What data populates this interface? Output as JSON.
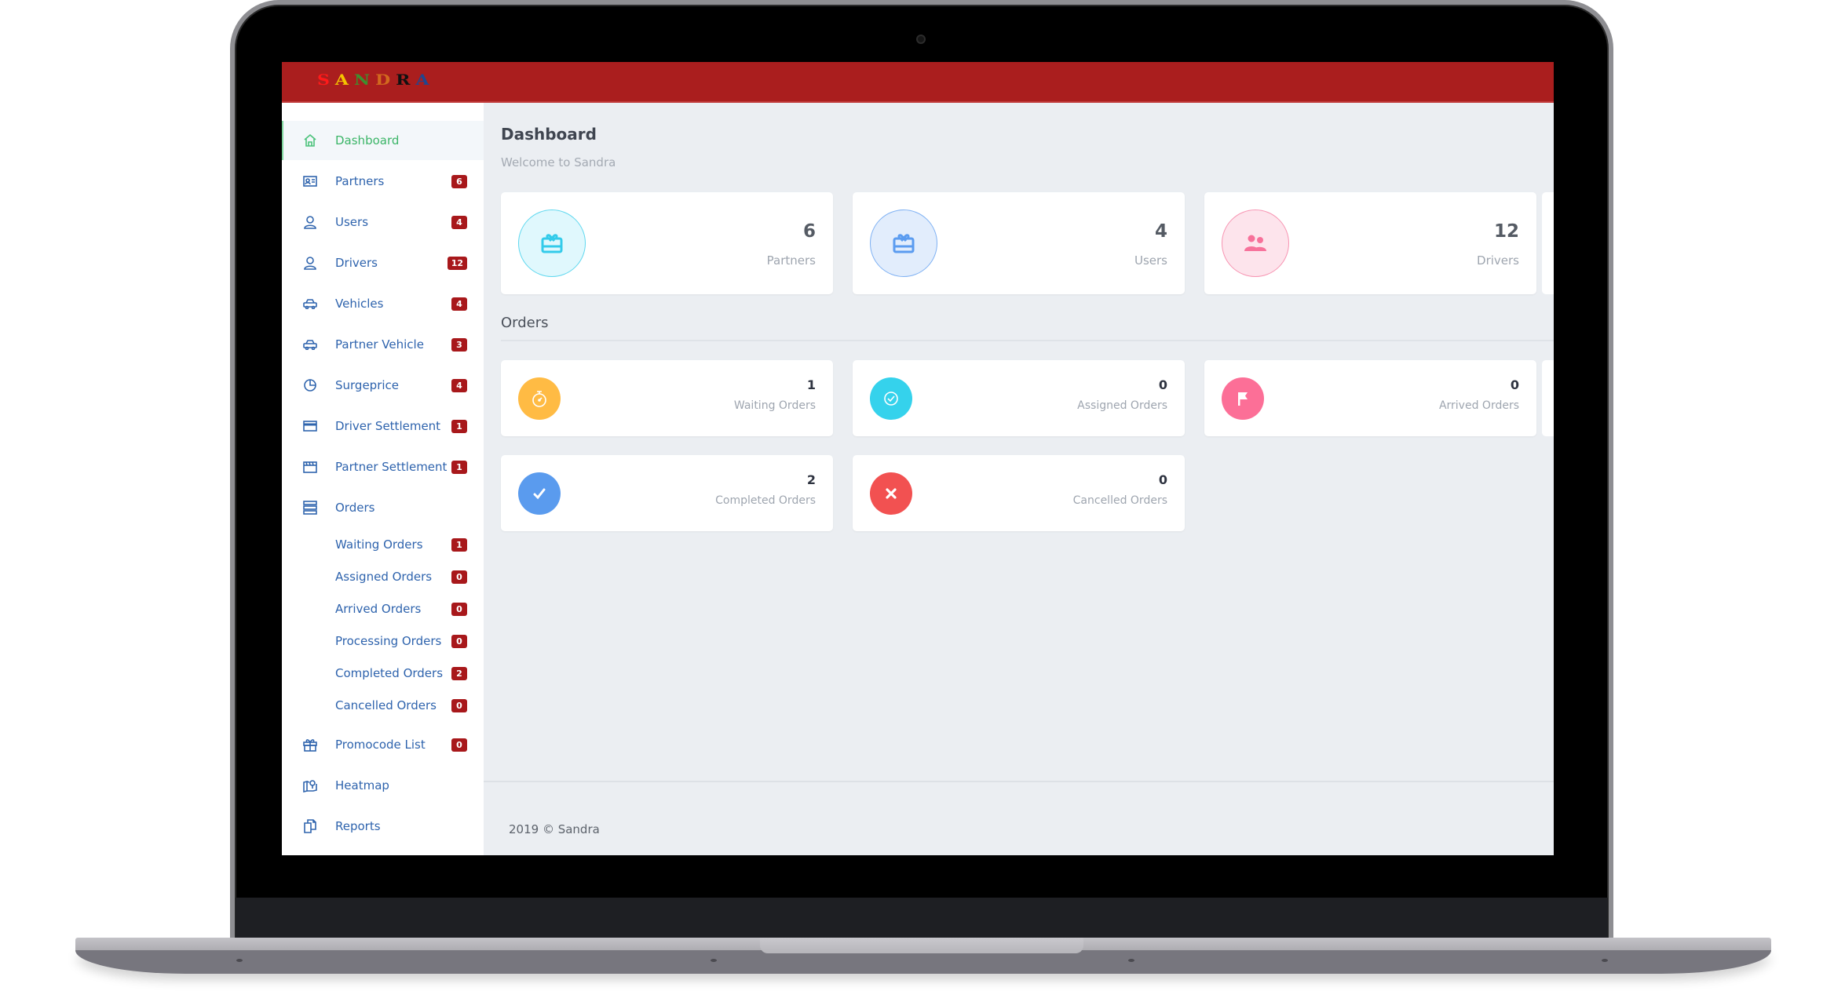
{
  "app": {
    "logo_letters": [
      {
        "char": "S",
        "color": "#ff1a1a"
      },
      {
        "char": "A",
        "color": "#f5c400"
      },
      {
        "char": "N",
        "color": "#3f8f2f"
      },
      {
        "char": "D",
        "color": "#d2691e"
      },
      {
        "char": "R",
        "color": "#111111"
      },
      {
        "char": "A",
        "color": "#21468f"
      }
    ],
    "header_color": "#aa1e1e"
  },
  "sidebar": {
    "items": [
      {
        "label": "Dashboard",
        "icon": "home-icon",
        "active": true
      },
      {
        "label": "Partners",
        "icon": "id-card-icon",
        "badge": "6"
      },
      {
        "label": "Users",
        "icon": "user-icon",
        "badge": "4"
      },
      {
        "label": "Drivers",
        "icon": "user-icon",
        "badge": "12"
      },
      {
        "label": "Vehicles",
        "icon": "car-icon",
        "badge": "4"
      },
      {
        "label": "Partner Vehicle",
        "icon": "car-icon",
        "badge": "3"
      },
      {
        "label": "Surgeprice",
        "icon": "pie-chart-icon",
        "badge": "4"
      },
      {
        "label": "Driver Settlement",
        "icon": "credit-card-icon",
        "badge": "1"
      },
      {
        "label": "Partner Settlement",
        "icon": "clapperboard-icon",
        "badge": "1"
      },
      {
        "label": "Orders",
        "icon": "list-icon"
      }
    ],
    "order_subitems": [
      {
        "label": "Waiting Orders",
        "badge": "1"
      },
      {
        "label": "Assigned Orders",
        "badge": "0"
      },
      {
        "label": "Arrived Orders",
        "badge": "0"
      },
      {
        "label": "Processing Orders",
        "badge": "0"
      },
      {
        "label": "Completed Orders",
        "badge": "2"
      },
      {
        "label": "Cancelled Orders",
        "badge": "0"
      }
    ],
    "bottom_items": [
      {
        "label": "Promocode List",
        "icon": "gift-icon",
        "badge": "0"
      },
      {
        "label": "Heatmap",
        "icon": "map-pin-icon"
      },
      {
        "label": "Reports",
        "icon": "copy-documents-icon"
      }
    ]
  },
  "main": {
    "title": "Dashboard",
    "subtitle": "Welcome to Sandra",
    "stats": [
      {
        "value": "6",
        "label": "Partners",
        "icon": "gift-card-icon",
        "color": "#33cbea",
        "bg": "#e0f8fd"
      },
      {
        "value": "4",
        "label": "Users",
        "icon": "gift-card-icon",
        "color": "#5b9cf0",
        "bg": "#e2edfc"
      },
      {
        "value": "12",
        "label": "Drivers",
        "icon": "users-group-icon",
        "color": "#f7719a",
        "bg": "#fde4ec"
      }
    ],
    "orders_title": "Orders",
    "orders": [
      {
        "value": "1",
        "label": "Waiting Orders",
        "icon": "stopwatch-icon",
        "color": "#ffbb44"
      },
      {
        "value": "0",
        "label": "Assigned Orders",
        "icon": "check-circle-icon",
        "color": "#35d2ec"
      },
      {
        "value": "0",
        "label": "Arrived Orders",
        "icon": "flag-icon",
        "color": "#fc6f97"
      },
      {
        "value": "2",
        "label": "Completed Orders",
        "icon": "checkmark-icon",
        "color": "#5a9bee"
      },
      {
        "value": "0",
        "label": "Cancelled Orders",
        "icon": "close-icon",
        "color": "#f25151"
      }
    ]
  },
  "footer": {
    "text": "2019 © Sandra"
  }
}
